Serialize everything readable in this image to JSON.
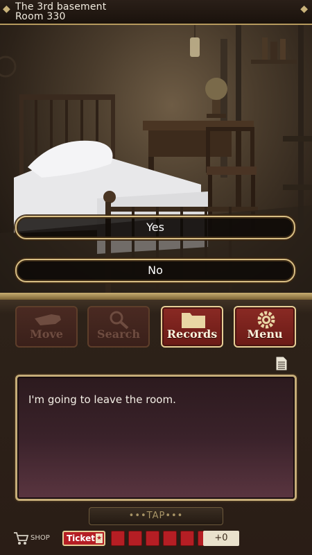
{
  "header": {
    "location_line1": "The 3rd basement",
    "location_line2": "Room 330"
  },
  "choices": {
    "yes": "Yes",
    "no": "No"
  },
  "commands": {
    "move": "Move",
    "search": "Search",
    "records": "Records",
    "menu": "Menu"
  },
  "message": {
    "text": "I'm going to leave the room."
  },
  "tap_label": "•••TAP•••",
  "footer": {
    "shop_label": "SHOP",
    "ticket_label": "Ticket",
    "ticket_slots": 6,
    "ticket_count": "+0"
  },
  "icons": {
    "move": "hand-pointing-icon",
    "search": "magnifier-icon",
    "records": "folder-icon",
    "menu": "gear-icon",
    "log": "document-icon",
    "shop": "cart-icon"
  },
  "colors": {
    "accent_gold": "#c6ad78",
    "active_red": "#8a2a24",
    "ticket_red": "#b51e24"
  }
}
